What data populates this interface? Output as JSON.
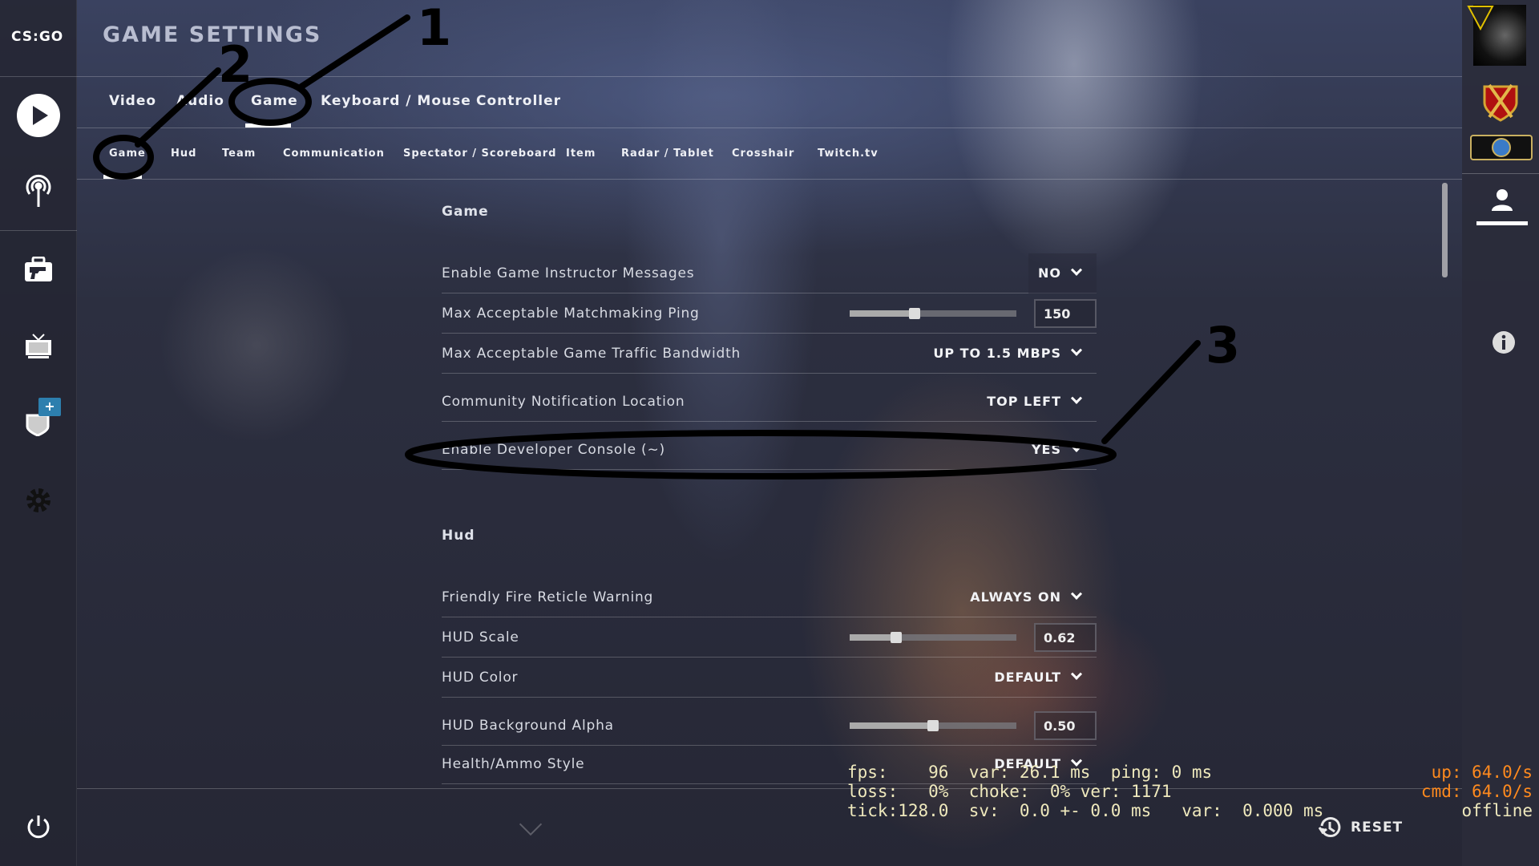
{
  "app": {
    "logo": "CS:GO",
    "title": "GAME SETTINGS"
  },
  "sidebar": {
    "items": [
      {
        "icon": "play-icon"
      },
      {
        "icon": "broadcast-icon"
      },
      {
        "icon": "inventory-briefcase-icon"
      },
      {
        "icon": "tv-watch-icon"
      },
      {
        "icon": "shield-icon",
        "badge": "+"
      },
      {
        "icon": "gear-icon"
      },
      {
        "icon": "power-icon"
      }
    ]
  },
  "tabs": [
    {
      "label": "Video"
    },
    {
      "label": "Audio"
    },
    {
      "label": "Game",
      "active": true
    },
    {
      "label": "Keyboard / Mouse"
    },
    {
      "label": "Controller"
    }
  ],
  "subtabs": [
    {
      "label": "Game",
      "active": true
    },
    {
      "label": "Hud"
    },
    {
      "label": "Team"
    },
    {
      "label": "Communication"
    },
    {
      "label": "Spectator / Scoreboard"
    },
    {
      "label": "Item"
    },
    {
      "label": "Radar / Tablet"
    },
    {
      "label": "Crosshair"
    },
    {
      "label": "Twitch.tv"
    }
  ],
  "sections": [
    {
      "title": "Game",
      "rows": [
        {
          "label": "Enable Game Instructor Messages",
          "type": "dropdown",
          "value": "NO"
        },
        {
          "label": "Max Acceptable Matchmaking Ping",
          "type": "slider",
          "value": "150",
          "fraction": 0.39
        },
        {
          "label": "Max Acceptable Game Traffic Bandwidth",
          "type": "dropdown",
          "value": "UP TO 1.5 MBPS"
        },
        {
          "label": "Community Notification Location",
          "type": "dropdown",
          "value": "TOP LEFT"
        },
        {
          "label": "Enable Developer Console (~)",
          "type": "dropdown",
          "value": "YES"
        }
      ]
    },
    {
      "title": "Hud",
      "rows": [
        {
          "label": "Friendly Fire Reticle Warning",
          "type": "dropdown",
          "value": "ALWAYS ON"
        },
        {
          "label": "HUD Scale",
          "type": "slider",
          "value": "0.62",
          "fraction": 0.28
        },
        {
          "label": "HUD Color",
          "type": "dropdown",
          "value": "DEFAULT"
        },
        {
          "label": "HUD Background Alpha",
          "type": "slider",
          "value": "0.50",
          "fraction": 0.5
        },
        {
          "label": "Health/Ammo Style",
          "type": "dropdown",
          "value": "DEFAULT"
        }
      ]
    }
  ],
  "netgraph": {
    "left": [
      "fps:    96  var: 26.1 ms  ping: 0 ms",
      "loss:   0%  choke:  0% ver: 1171",
      "tick:128.0  sv:  0.0 +- 0.0 ms   var:  0.000 ms"
    ],
    "right": [
      "up: 64.0/s",
      "cmd: 64.0/s",
      "offline"
    ],
    "colors": {
      "text": "#efe9bd",
      "rate": "#ff8a1e"
    }
  },
  "footer": {
    "reset_label": "RESET"
  },
  "rightbar": {
    "items": [
      {
        "icon": "avatar"
      },
      {
        "icon": "rank-badge-icon"
      },
      {
        "icon": "rank-emblem-icon"
      },
      {
        "icon": "profile-icon"
      },
      {
        "icon": "info-icon"
      }
    ]
  },
  "annotations": [
    "1",
    "2",
    "3"
  ]
}
